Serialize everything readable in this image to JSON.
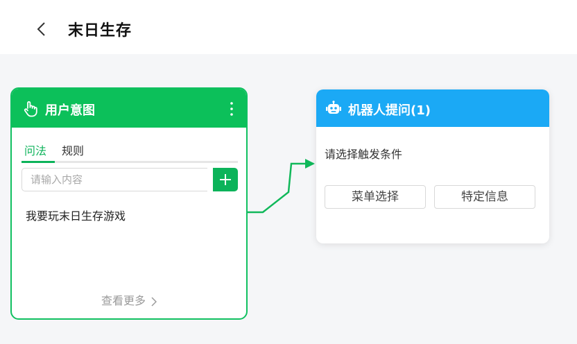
{
  "header": {
    "title": "末日生存"
  },
  "intent_card": {
    "title": "用户意图",
    "tabs": [
      {
        "label": "问法"
      },
      {
        "label": "规则"
      }
    ],
    "input": {
      "placeholder": "请输入内容",
      "value": ""
    },
    "phrases": [
      "我要玩末日生存游戏"
    ],
    "view_more": "查看更多"
  },
  "bot_card": {
    "title": "机器人提问(1)",
    "hint": "请选择触发条件",
    "options": [
      {
        "label": "菜单选择"
      },
      {
        "label": "特定信息"
      }
    ]
  },
  "colors": {
    "intent_green": "#0cc05a",
    "bot_blue": "#1ba9f5",
    "background": "#f5f6f8"
  },
  "icons": {
    "back": "chevron-left-icon",
    "intent": "hand-pointer-icon",
    "menu": "more-vertical-icon",
    "add": "plus-icon",
    "bot": "robot-icon",
    "view_more": "chevron-right-icon"
  }
}
